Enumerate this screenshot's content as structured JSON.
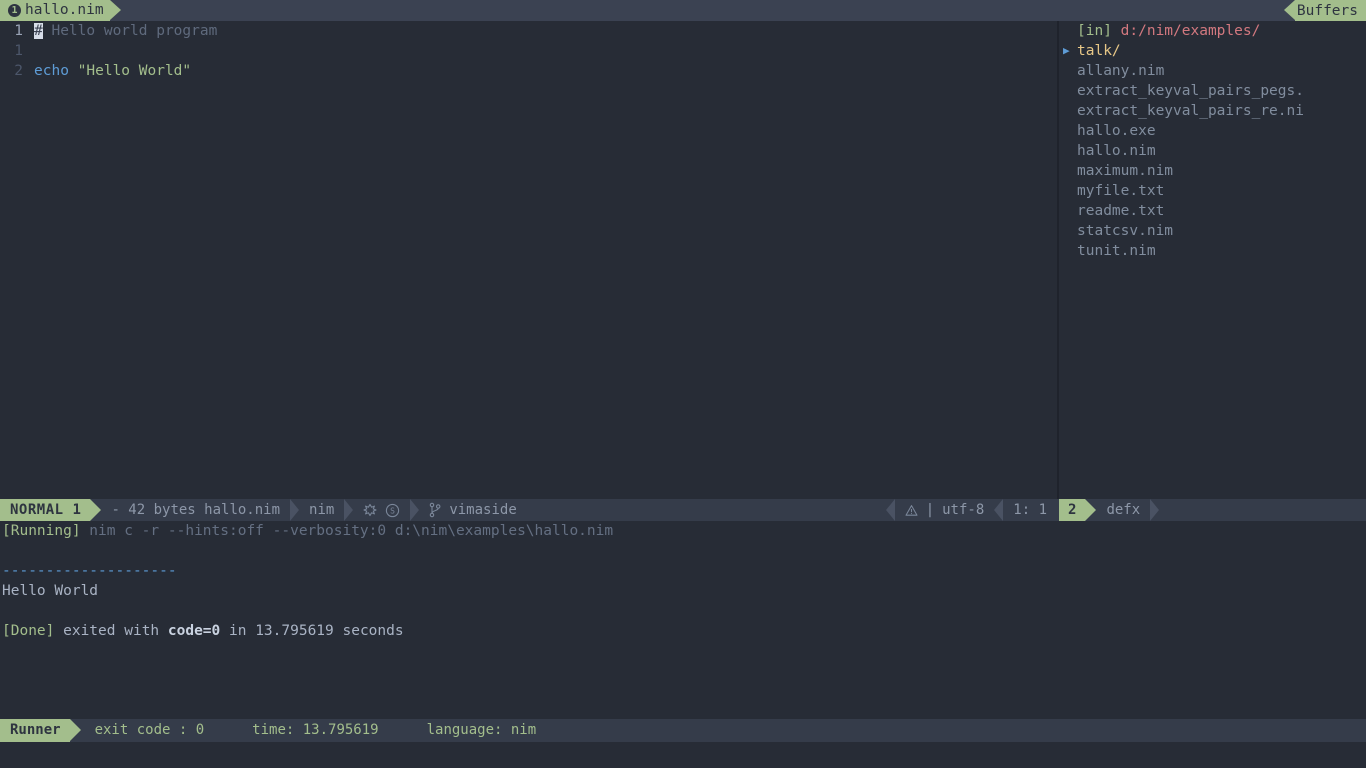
{
  "tab": {
    "number": "1",
    "filename": "hallo.nim"
  },
  "sidebar_header": {
    "label": "Buffers"
  },
  "editor": {
    "lines": [
      {
        "num": "1",
        "current": true,
        "segments": [
          {
            "text": "#",
            "kind": "cursor"
          },
          {
            "text": " Hello world program",
            "kind": "comment"
          }
        ]
      },
      {
        "num": "1",
        "current": false,
        "segments": []
      },
      {
        "num": "2",
        "current": false,
        "segments": [
          {
            "text": "echo",
            "kind": "keyword"
          },
          {
            "text": " ",
            "kind": "plain"
          },
          {
            "text": "\"Hello World\"",
            "kind": "string"
          }
        ]
      }
    ]
  },
  "file_explorer": {
    "root_tag": "[in]",
    "root_path": "d:/nim/examples/",
    "entries": [
      {
        "name": "talk/",
        "kind": "dir",
        "expand_marker": "▶"
      },
      {
        "name": "allany.nim",
        "kind": "file",
        "expand_marker": ""
      },
      {
        "name": "extract_keyval_pairs_pegs.",
        "kind": "file",
        "expand_marker": ""
      },
      {
        "name": "extract_keyval_pairs_re.ni",
        "kind": "file",
        "expand_marker": ""
      },
      {
        "name": "hallo.exe",
        "kind": "file",
        "expand_marker": ""
      },
      {
        "name": "hallo.nim",
        "kind": "file",
        "expand_marker": ""
      },
      {
        "name": "maximum.nim",
        "kind": "file",
        "expand_marker": ""
      },
      {
        "name": "myfile.txt",
        "kind": "file",
        "expand_marker": ""
      },
      {
        "name": "readme.txt",
        "kind": "file",
        "expand_marker": ""
      },
      {
        "name": "statcsv.nim",
        "kind": "file",
        "expand_marker": ""
      },
      {
        "name": "tunit.nim",
        "kind": "file",
        "expand_marker": ""
      }
    ]
  },
  "statusline": {
    "mode": "NORMAL 1",
    "file_info": "- 42 bytes hallo.nim",
    "filetype": "nim",
    "diff_icon": "git-diff-icon",
    "spell_icon": "spell-check-icon",
    "branch_icon": "git-branch-icon",
    "branch": "vimaside",
    "warning_icon": "warning-icon",
    "separator": "|",
    "encoding": "utf-8",
    "position": "1:   1"
  },
  "statusline_right": {
    "window_number": "2",
    "label": "defx"
  },
  "terminal": {
    "lines": [
      {
        "type": "running",
        "tag": "[Running]",
        "command": " nim c -r --hints:off --verbosity:0 d:\\nim\\examples\\hallo.nim"
      },
      {
        "type": "blank",
        "text": ""
      },
      {
        "type": "dashes",
        "text": "--------------------"
      },
      {
        "type": "output",
        "text": "Hello World"
      },
      {
        "type": "blank",
        "text": ""
      },
      {
        "type": "done",
        "tag": "[Done]",
        "pre": " exited with ",
        "code": "code=0",
        "post": " in 13.795619 seconds"
      }
    ]
  },
  "runnerbar": {
    "label": "Runner",
    "exit_code": "exit code : 0",
    "time": "time: 13.795619",
    "language": "language: nim"
  },
  "colors": {
    "accent_green": "#a3be8c",
    "bg": "#272c36",
    "statusbar_bg": "#353c4a",
    "tabline_bg": "#3b4252",
    "path_red": "#d2787f",
    "dir_yellow": "#e7c787",
    "keyword_blue": "#5e9cd6"
  }
}
